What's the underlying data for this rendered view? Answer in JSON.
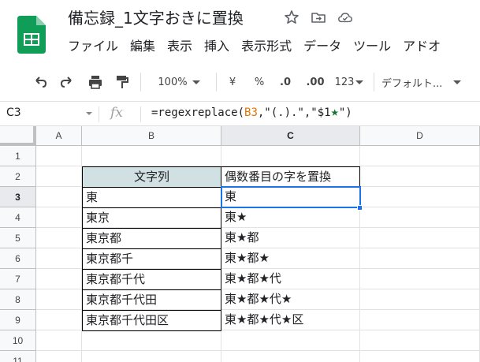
{
  "header": {
    "title": "備忘録_1文字おきに置換",
    "menu": [
      "ファイル",
      "編集",
      "表示",
      "挿入",
      "表示形式",
      "データ",
      "ツール",
      "アドオ"
    ]
  },
  "toolbar": {
    "zoom": "100%",
    "currency": "¥",
    "percent": "%",
    "decimal_decrease": ".0",
    "decimal_increase": ".00",
    "number_format": "123",
    "font": "デフォルト..."
  },
  "formula_bar": {
    "name_box": "C3",
    "fx": "fx",
    "formula_prefix": "=regexreplace(",
    "formula_ref": "B3",
    "formula_middle": ",\"(.).\",\"$1",
    "formula_star": "★",
    "formula_suffix": "\")"
  },
  "sheet": {
    "columns": [
      "A",
      "B",
      "C",
      "D"
    ],
    "rows": [
      "1",
      "2",
      "3",
      "4",
      "5",
      "6",
      "7",
      "8",
      "9",
      "10",
      "11"
    ],
    "table_header": [
      "文字列",
      "偶数番目の字を置換"
    ],
    "table_rows": [
      [
        "東",
        "東"
      ],
      [
        "東京",
        "東★"
      ],
      [
        "東京都",
        "東★都"
      ],
      [
        "東京都千",
        "東★都★"
      ],
      [
        "東京都千代",
        "東★都★代"
      ],
      [
        "東京都千代田",
        "東★都★代★"
      ],
      [
        "東京都千代田区",
        "東★都★代★区"
      ]
    ]
  },
  "colors": {
    "accent": "#1a73e8",
    "header_fill": "#d0e0e3",
    "logo_green": "#0f9d58",
    "ref_orange": "#e37400",
    "star_green": "#137333"
  }
}
